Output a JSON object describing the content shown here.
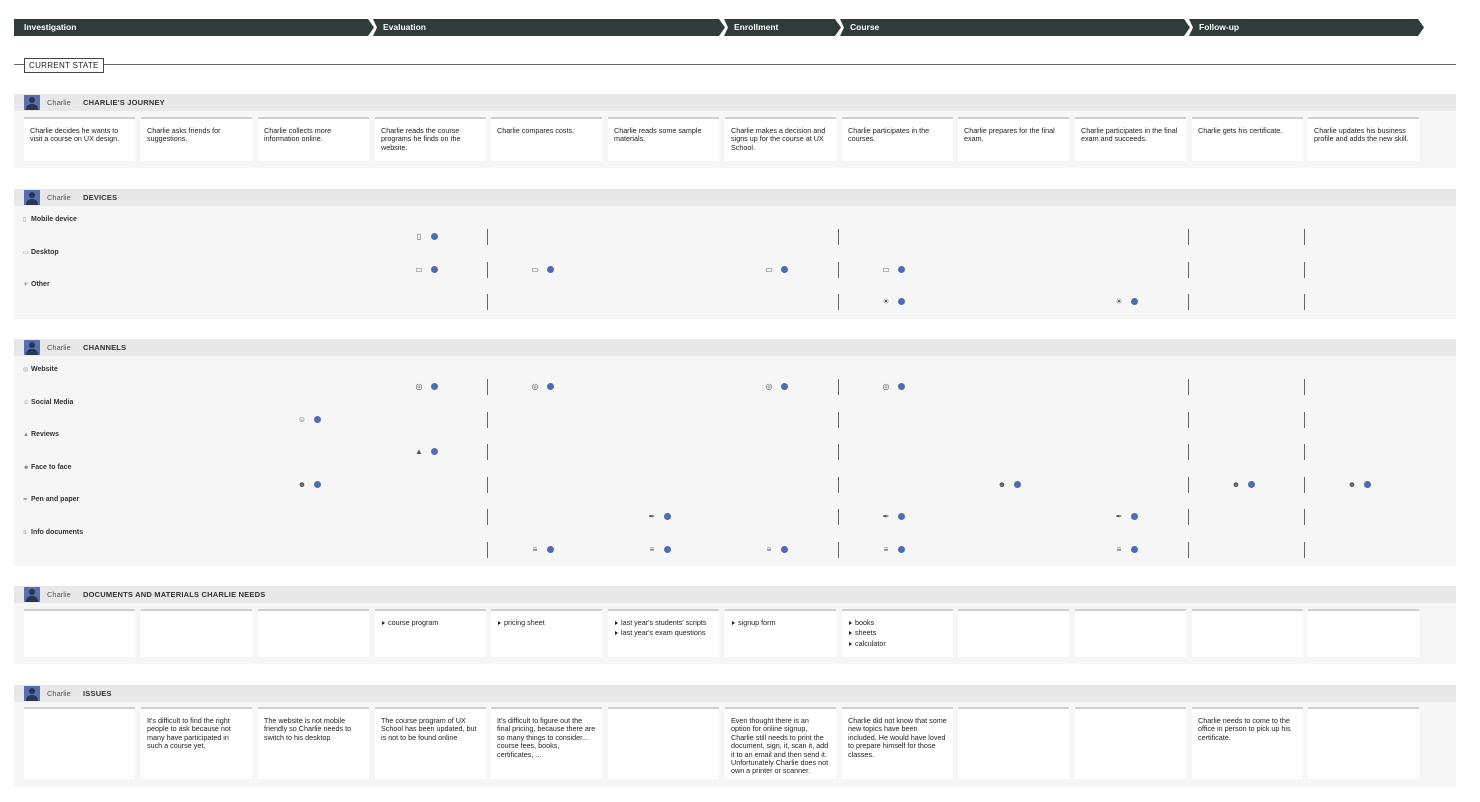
{
  "phases": [
    {
      "label": "Investigation"
    },
    {
      "label": "Evaluation"
    },
    {
      "label": "Enrollment"
    },
    {
      "label": "Course"
    },
    {
      "label": "Follow-up"
    }
  ],
  "state_label": "CURRENT STATE",
  "persona": "Charlie",
  "colors": {
    "phase_bg": "#2f3c3a",
    "dot": "#4f6bb5"
  },
  "journey": {
    "title": "CHARLIE'S JOURNEY",
    "steps": [
      "Charlie decides he wants to visit a course on UX design.",
      "Charlie asks friends for suggestions.",
      "Charlie collects more information online.",
      "Charlie reads the course programs he finds on the website.",
      "Charlie compares costs.",
      "Charlie reads some sample materials.",
      "Charlie makes a decision and signs up for the course at UX School.",
      "Charlie participates in the courses.",
      "Charlie prepares for the final exam.",
      "Charlie participates in the final exam and succeeds.",
      "Charlie gets his certificate.",
      "Charlie updates his business profile and adds the new skill."
    ]
  },
  "devices": {
    "title": "DEVICES",
    "rows": [
      {
        "label": "Mobile device",
        "icon": "mobile-icon",
        "steps": [
          3
        ]
      },
      {
        "label": "Desktop",
        "icon": "desktop-icon",
        "steps": [
          3,
          4,
          6,
          7
        ]
      },
      {
        "label": "Other",
        "icon": "gadget-icon",
        "steps": [
          7,
          9
        ]
      }
    ]
  },
  "channels": {
    "title": "CHANNELS",
    "rows": [
      {
        "label": "Website",
        "icon": "website-icon",
        "steps": [
          3,
          4,
          6,
          7
        ]
      },
      {
        "label": "Social Media",
        "icon": "social-media-icon",
        "steps": [
          2
        ]
      },
      {
        "label": "Reviews",
        "icon": "thumbs-up-icon",
        "steps": [
          3
        ]
      },
      {
        "label": "Face to face",
        "icon": "face-to-face-icon",
        "steps": [
          2,
          8,
          10,
          11
        ]
      },
      {
        "label": "Pen and paper",
        "icon": "pen-icon",
        "steps": [
          5,
          7,
          9
        ]
      },
      {
        "label": "Info documents",
        "icon": "document-icon",
        "steps": [
          4,
          5,
          6,
          7,
          9
        ]
      }
    ]
  },
  "documents": {
    "title": "DOCUMENTS AND MATERIALS CHARLIE NEEDS",
    "steps": [
      [],
      [],
      [],
      [
        "course program"
      ],
      [
        "pricing sheet"
      ],
      [
        "last year's students' scripts",
        "last year's exam questions"
      ],
      [
        "signup form"
      ],
      [
        "books",
        "sheets",
        "calculator"
      ],
      [],
      [],
      [],
      []
    ]
  },
  "issues": {
    "title": "ISSUES",
    "steps": [
      "",
      "It's difficult to find the right people to ask because not many have participated in such a course yet.",
      "The website is not mobile friendly so Charlie needs to switch to his desktop",
      "The course program of UX School has been updated, but is not to be found online",
      "It's difficult to figure out the final pricing, because there are so many things to consider... course fees, books, certificates, ...",
      "",
      "Even thought there is an option for online signup, Charlie still needs to print the document, sign, it, scan it, add it to an email and then send it. Unfortunately Charlie does not own a printer or scanner.",
      "Charlie did not know that some new topics have been included. He would have loved to prepare himself for those classes.",
      "",
      "",
      "Charlie needs to come to the office in person to pick up his certificate.",
      ""
    ]
  }
}
